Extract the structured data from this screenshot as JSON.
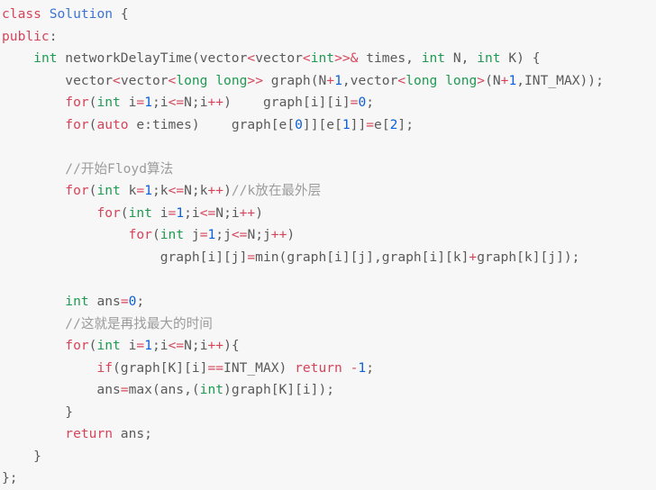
{
  "editor": {
    "language": "cpp",
    "background_color": "#f7f7f7",
    "palette": {
      "keyword": "#d6445a",
      "type": "#1f9a52",
      "class_name": "#3b74d6",
      "number": "#0b5fd9",
      "operator": "#d6445a",
      "comment": "#9b9b9b",
      "plain": "#5a5a5a"
    }
  },
  "code": {
    "lines": [
      {
        "n": 1,
        "text": "class Solution {",
        "tokens": [
          {
            "t": "class",
            "c": "kw"
          },
          {
            "t": " ",
            "c": "pln"
          },
          {
            "t": "Solution",
            "c": "cls"
          },
          {
            "t": " {",
            "c": "pln"
          }
        ]
      },
      {
        "n": 2,
        "text": "public:",
        "tokens": [
          {
            "t": "public",
            "c": "kw"
          },
          {
            "t": ":",
            "c": "pln"
          }
        ]
      },
      {
        "n": 3,
        "text": "    int networkDelayTime(vector<vector<int>>& times, int N, int K) {",
        "tokens": [
          {
            "t": "    ",
            "c": "pln"
          },
          {
            "t": "int",
            "c": "typ"
          },
          {
            "t": " networkDelayTime(vector",
            "c": "pln"
          },
          {
            "t": "<",
            "c": "op"
          },
          {
            "t": "vector",
            "c": "pln"
          },
          {
            "t": "<",
            "c": "op"
          },
          {
            "t": "int",
            "c": "typ"
          },
          {
            "t": ">>&",
            "c": "op"
          },
          {
            "t": " times, ",
            "c": "pln"
          },
          {
            "t": "int",
            "c": "typ"
          },
          {
            "t": " N, ",
            "c": "pln"
          },
          {
            "t": "int",
            "c": "typ"
          },
          {
            "t": " K) {",
            "c": "pln"
          }
        ]
      },
      {
        "n": 4,
        "text": "        vector<vector<long long>> graph(N+1,vector<long long>(N+1,INT_MAX));",
        "tokens": [
          {
            "t": "        vector",
            "c": "pln"
          },
          {
            "t": "<",
            "c": "op"
          },
          {
            "t": "vector",
            "c": "pln"
          },
          {
            "t": "<",
            "c": "op"
          },
          {
            "t": "long long",
            "c": "typ"
          },
          {
            "t": ">>",
            "c": "op"
          },
          {
            "t": " graph(N",
            "c": "pln"
          },
          {
            "t": "+",
            "c": "op"
          },
          {
            "t": "1",
            "c": "num"
          },
          {
            "t": ",vector",
            "c": "pln"
          },
          {
            "t": "<",
            "c": "op"
          },
          {
            "t": "long long",
            "c": "typ"
          },
          {
            "t": ">",
            "c": "op"
          },
          {
            "t": "(N",
            "c": "pln"
          },
          {
            "t": "+",
            "c": "op"
          },
          {
            "t": "1",
            "c": "num"
          },
          {
            "t": ",INT_MAX));",
            "c": "pln"
          }
        ]
      },
      {
        "n": 5,
        "text": "        for(int i=1;i<=N;i++)    graph[i][i]=0;",
        "tokens": [
          {
            "t": "        ",
            "c": "pln"
          },
          {
            "t": "for",
            "c": "kw"
          },
          {
            "t": "(",
            "c": "pln"
          },
          {
            "t": "int",
            "c": "typ"
          },
          {
            "t": " i",
            "c": "pln"
          },
          {
            "t": "=",
            "c": "op"
          },
          {
            "t": "1",
            "c": "num"
          },
          {
            "t": ";i",
            "c": "pln"
          },
          {
            "t": "<=",
            "c": "op"
          },
          {
            "t": "N;i",
            "c": "pln"
          },
          {
            "t": "++",
            "c": "op"
          },
          {
            "t": ")    graph[i][i]",
            "c": "pln"
          },
          {
            "t": "=",
            "c": "op"
          },
          {
            "t": "0",
            "c": "num"
          },
          {
            "t": ";",
            "c": "pln"
          }
        ]
      },
      {
        "n": 6,
        "text": "        for(auto e:times)    graph[e[0]][e[1]]=e[2];",
        "tokens": [
          {
            "t": "        ",
            "c": "pln"
          },
          {
            "t": "for",
            "c": "kw"
          },
          {
            "t": "(",
            "c": "pln"
          },
          {
            "t": "auto",
            "c": "kw"
          },
          {
            "t": " e:times)    graph[e[",
            "c": "pln"
          },
          {
            "t": "0",
            "c": "num"
          },
          {
            "t": "]][e[",
            "c": "pln"
          },
          {
            "t": "1",
            "c": "num"
          },
          {
            "t": "]]",
            "c": "pln"
          },
          {
            "t": "=",
            "c": "op"
          },
          {
            "t": "e[",
            "c": "pln"
          },
          {
            "t": "2",
            "c": "num"
          },
          {
            "t": "];",
            "c": "pln"
          }
        ]
      },
      {
        "n": 7,
        "text": "",
        "tokens": []
      },
      {
        "n": 8,
        "text": "        //开始Floyd算法",
        "tokens": [
          {
            "t": "        ",
            "c": "pln"
          },
          {
            "t": "//开始Floyd算法",
            "c": "cmt"
          }
        ]
      },
      {
        "n": 9,
        "text": "        for(int k=1;k<=N;k++)//k放在最外层",
        "tokens": [
          {
            "t": "        ",
            "c": "pln"
          },
          {
            "t": "for",
            "c": "kw"
          },
          {
            "t": "(",
            "c": "pln"
          },
          {
            "t": "int",
            "c": "typ"
          },
          {
            "t": " k",
            "c": "pln"
          },
          {
            "t": "=",
            "c": "op"
          },
          {
            "t": "1",
            "c": "num"
          },
          {
            "t": ";k",
            "c": "pln"
          },
          {
            "t": "<=",
            "c": "op"
          },
          {
            "t": "N;k",
            "c": "pln"
          },
          {
            "t": "++",
            "c": "op"
          },
          {
            "t": ")",
            "c": "pln"
          },
          {
            "t": "//k放在最外层",
            "c": "cmt"
          }
        ]
      },
      {
        "n": 10,
        "text": "            for(int i=1;i<=N;i++)",
        "tokens": [
          {
            "t": "            ",
            "c": "pln"
          },
          {
            "t": "for",
            "c": "kw"
          },
          {
            "t": "(",
            "c": "pln"
          },
          {
            "t": "int",
            "c": "typ"
          },
          {
            "t": " i",
            "c": "pln"
          },
          {
            "t": "=",
            "c": "op"
          },
          {
            "t": "1",
            "c": "num"
          },
          {
            "t": ";i",
            "c": "pln"
          },
          {
            "t": "<=",
            "c": "op"
          },
          {
            "t": "N;i",
            "c": "pln"
          },
          {
            "t": "++",
            "c": "op"
          },
          {
            "t": ")",
            "c": "pln"
          }
        ]
      },
      {
        "n": 11,
        "text": "                for(int j=1;j<=N;j++)",
        "tokens": [
          {
            "t": "                ",
            "c": "pln"
          },
          {
            "t": "for",
            "c": "kw"
          },
          {
            "t": "(",
            "c": "pln"
          },
          {
            "t": "int",
            "c": "typ"
          },
          {
            "t": " j",
            "c": "pln"
          },
          {
            "t": "=",
            "c": "op"
          },
          {
            "t": "1",
            "c": "num"
          },
          {
            "t": ";j",
            "c": "pln"
          },
          {
            "t": "<=",
            "c": "op"
          },
          {
            "t": "N;j",
            "c": "pln"
          },
          {
            "t": "++",
            "c": "op"
          },
          {
            "t": ")",
            "c": "pln"
          }
        ]
      },
      {
        "n": 12,
        "text": "                    graph[i][j]=min(graph[i][j],graph[i][k]+graph[k][j]);",
        "tokens": [
          {
            "t": "                    graph[i][j]",
            "c": "pln"
          },
          {
            "t": "=",
            "c": "op"
          },
          {
            "t": "min(graph[i][j],graph[i][k]",
            "c": "pln"
          },
          {
            "t": "+",
            "c": "op"
          },
          {
            "t": "graph[k][j]);",
            "c": "pln"
          }
        ]
      },
      {
        "n": 13,
        "text": "",
        "tokens": []
      },
      {
        "n": 14,
        "text": "        int ans=0;",
        "tokens": [
          {
            "t": "        ",
            "c": "pln"
          },
          {
            "t": "int",
            "c": "typ"
          },
          {
            "t": " ans",
            "c": "pln"
          },
          {
            "t": "=",
            "c": "op"
          },
          {
            "t": "0",
            "c": "num"
          },
          {
            "t": ";",
            "c": "pln"
          }
        ]
      },
      {
        "n": 15,
        "text": "        //这就是再找最大的时间",
        "tokens": [
          {
            "t": "        ",
            "c": "pln"
          },
          {
            "t": "//这就是再找最大的时间",
            "c": "cmt"
          }
        ]
      },
      {
        "n": 16,
        "text": "        for(int i=1;i<=N;i++){",
        "tokens": [
          {
            "t": "        ",
            "c": "pln"
          },
          {
            "t": "for",
            "c": "kw"
          },
          {
            "t": "(",
            "c": "pln"
          },
          {
            "t": "int",
            "c": "typ"
          },
          {
            "t": " i",
            "c": "pln"
          },
          {
            "t": "=",
            "c": "op"
          },
          {
            "t": "1",
            "c": "num"
          },
          {
            "t": ";i",
            "c": "pln"
          },
          {
            "t": "<=",
            "c": "op"
          },
          {
            "t": "N;i",
            "c": "pln"
          },
          {
            "t": "++",
            "c": "op"
          },
          {
            "t": "){",
            "c": "pln"
          }
        ]
      },
      {
        "n": 17,
        "text": "            if(graph[K][i]==INT_MAX) return -1;",
        "tokens": [
          {
            "t": "            ",
            "c": "pln"
          },
          {
            "t": "if",
            "c": "kw"
          },
          {
            "t": "(graph[K][i]",
            "c": "pln"
          },
          {
            "t": "==",
            "c": "op"
          },
          {
            "t": "INT_MAX) ",
            "c": "pln"
          },
          {
            "t": "return",
            "c": "kw"
          },
          {
            "t": " ",
            "c": "pln"
          },
          {
            "t": "-",
            "c": "op"
          },
          {
            "t": "1",
            "c": "num"
          },
          {
            "t": ";",
            "c": "pln"
          }
        ]
      },
      {
        "n": 18,
        "text": "            ans=max(ans,(int)graph[K][i]);",
        "tokens": [
          {
            "t": "            ans",
            "c": "pln"
          },
          {
            "t": "=",
            "c": "op"
          },
          {
            "t": "max(ans,(",
            "c": "pln"
          },
          {
            "t": "int",
            "c": "typ"
          },
          {
            "t": ")graph[K][i]);",
            "c": "pln"
          }
        ]
      },
      {
        "n": 19,
        "text": "        }",
        "tokens": [
          {
            "t": "        }",
            "c": "pln"
          }
        ]
      },
      {
        "n": 20,
        "text": "        return ans;",
        "tokens": [
          {
            "t": "        ",
            "c": "pln"
          },
          {
            "t": "return",
            "c": "kw"
          },
          {
            "t": " ans;",
            "c": "pln"
          }
        ]
      },
      {
        "n": 21,
        "text": "    }",
        "tokens": [
          {
            "t": "    }",
            "c": "pln"
          }
        ]
      },
      {
        "n": 22,
        "text": "};",
        "tokens": [
          {
            "t": "};",
            "c": "pln"
          }
        ]
      }
    ]
  }
}
